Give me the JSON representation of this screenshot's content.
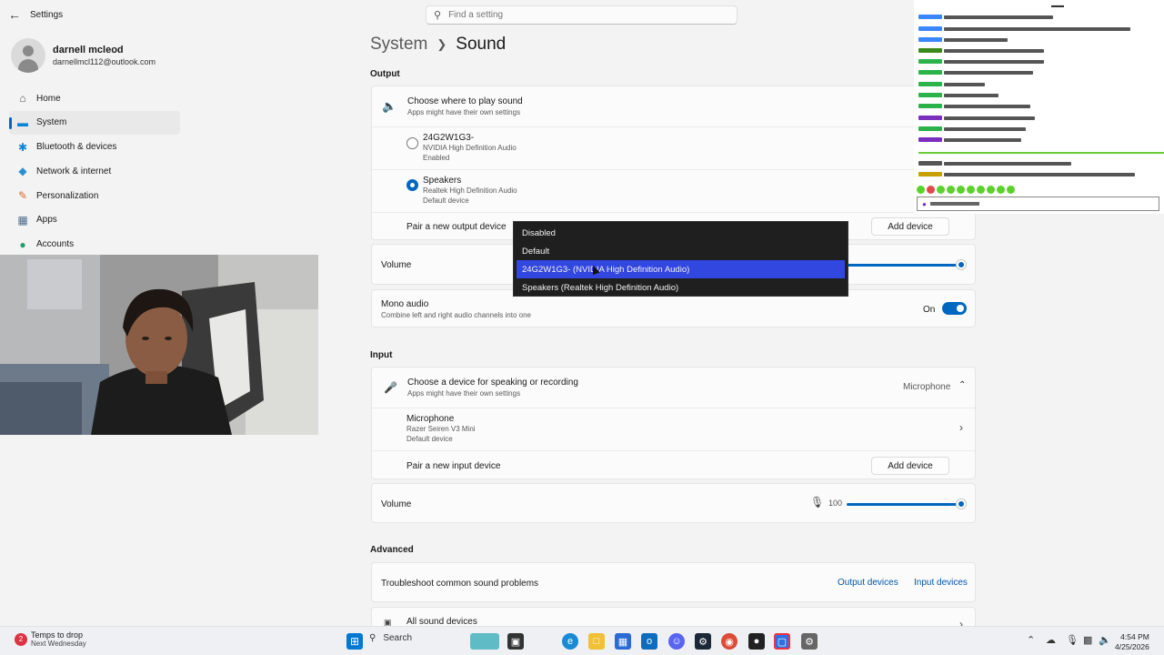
{
  "window": {
    "app_title": "Settings",
    "search_placeholder": "Find a setting"
  },
  "profile": {
    "name": "darnell mcleod",
    "email": "darnellmcl112@outlook.com"
  },
  "sidebar": {
    "items": [
      {
        "label": "Home",
        "icon": "home-icon",
        "color": "#555555"
      },
      {
        "label": "System",
        "icon": "system-icon",
        "color": "#0a84d6",
        "active": true
      },
      {
        "label": "Bluetooth & devices",
        "icon": "bluetooth-icon",
        "color": "#0a84d6"
      },
      {
        "label": "Network & internet",
        "icon": "network-icon",
        "color": "#2b8fd6"
      },
      {
        "label": "Personalization",
        "icon": "brush-icon",
        "color": "#d86a2b"
      },
      {
        "label": "Apps",
        "icon": "apps-icon",
        "color": "#4b6a8a"
      },
      {
        "label": "Accounts",
        "icon": "accounts-icon",
        "color": "#23a06a"
      }
    ]
  },
  "header": {
    "parent": "System",
    "current": "Sound"
  },
  "output": {
    "section_label": "Output",
    "choose_title": "Choose where to play sound",
    "choose_sub": "Apps might have their own settings",
    "devices": [
      {
        "name": "24G2W1G3-",
        "line1": "NVIDIA High Definition Audio",
        "line2": "Enabled",
        "selected": false
      },
      {
        "name": "Speakers",
        "line1": "Realtek High Definition Audio",
        "line2": "Default device",
        "selected": true
      }
    ],
    "pair_label": "Pair a new output device",
    "add_device_label": "Add device",
    "volume_label": "Volume",
    "mono_title": "Mono audio",
    "mono_sub": "Combine left and right audio channels into one",
    "mono_state": "On"
  },
  "dropdown": {
    "options": [
      {
        "label": "Disabled",
        "selected": false
      },
      {
        "label": "Default",
        "selected": false
      },
      {
        "label": "24G2W1G3- (NVIDIA High Definition Audio)",
        "selected": true
      },
      {
        "label": "Speakers (Realtek High Definition Audio)",
        "selected": false
      }
    ]
  },
  "input": {
    "section_label": "Input",
    "choose_title": "Choose a device for speaking or recording",
    "choose_sub": "Apps might have their own settings",
    "selected_device": "Microphone",
    "device_name": "Microphone",
    "device_line1": "Razer Seiren V3 Mini",
    "device_line2": "Default device",
    "pair_label": "Pair a new input device",
    "add_device_label": "Add device",
    "volume_label": "Volume",
    "volume_value": "100"
  },
  "advanced": {
    "section_label": "Advanced",
    "troubleshoot_label": "Troubleshoot common sound problems",
    "output_devices_link": "Output devices",
    "input_devices_link": "Input devices",
    "all_devices_label": "All sound devices"
  },
  "taskbar": {
    "weather_badge": "2",
    "weather_title": "Temps to drop",
    "weather_sub": "Next Wednesday",
    "search_label": "Search",
    "time": "4:54 PM",
    "date": "4/25/2026"
  },
  "accent_color": "#0067c0",
  "dropdown_highlight": "#3246e0"
}
